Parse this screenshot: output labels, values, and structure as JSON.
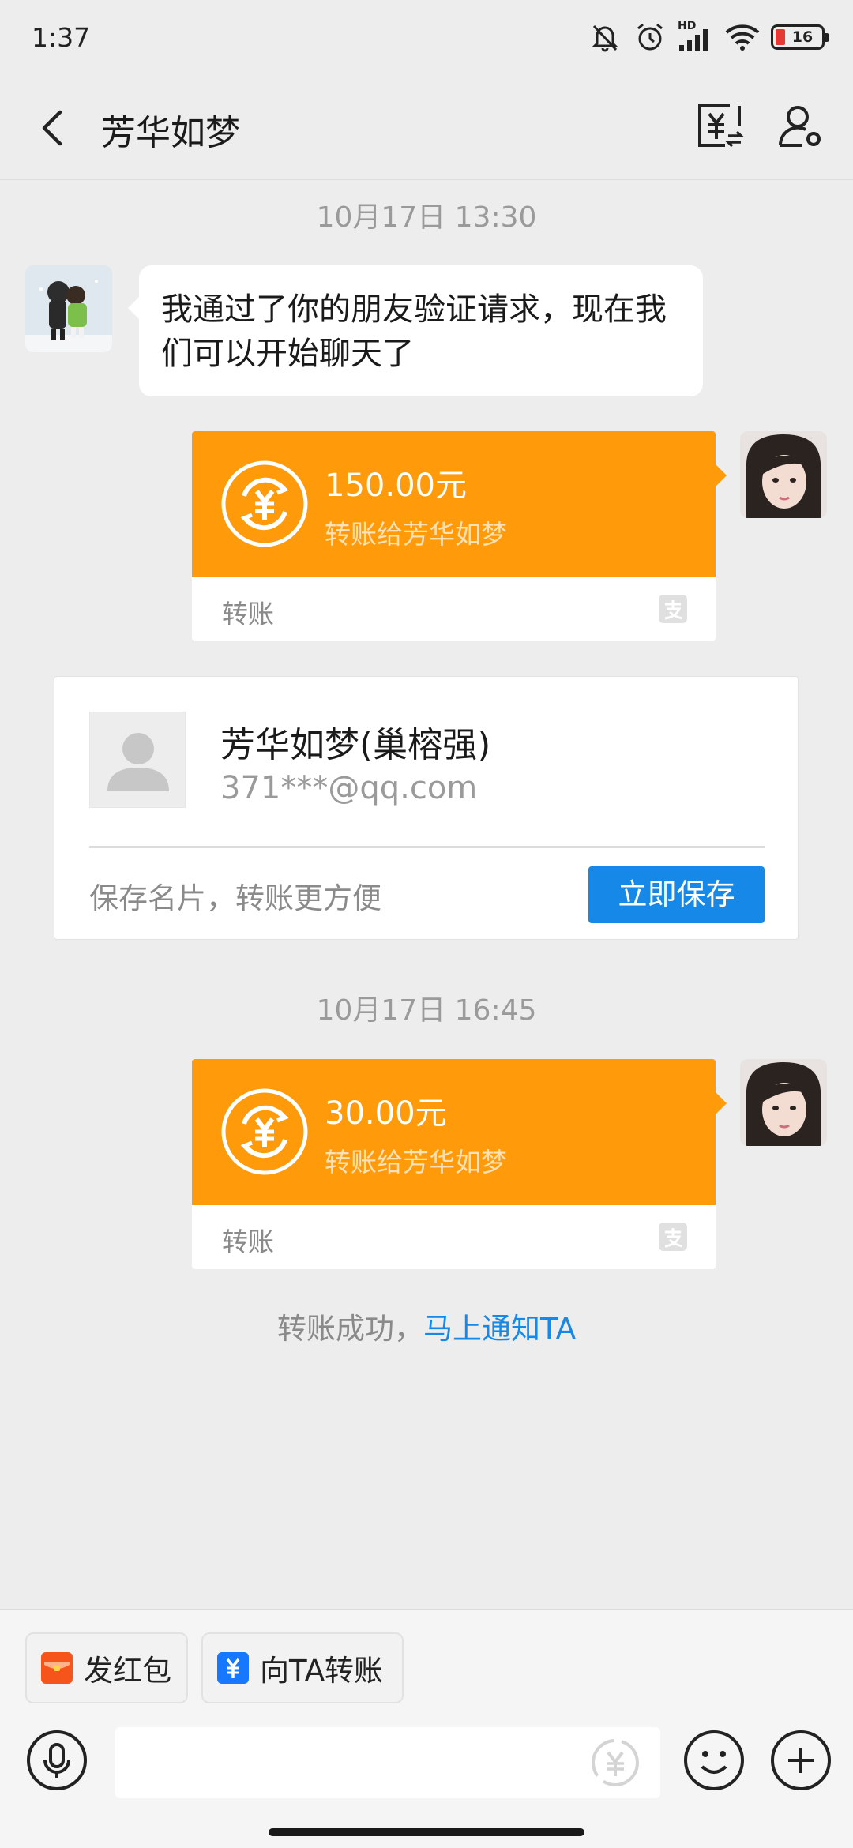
{
  "status_bar": {
    "time": "1:37",
    "network_label": "HD",
    "battery": "16"
  },
  "header": {
    "title": "芳华如梦",
    "back_icon": "chevron-left-icon",
    "transfer_icon": "yuan-transfer-icon",
    "profile_icon": "user-settings-icon"
  },
  "messages": {
    "ts1": "10月17日 13:30",
    "friend_message": "我通过了你的朋友验证请求，现在我们可以开始聊天了",
    "transfer1": {
      "amount": "150.00元",
      "desc": "转账给芳华如梦",
      "label": "转账"
    },
    "contact_card": {
      "name": "芳华如梦(巢榕强)",
      "email": "371***@qq.com",
      "hint": "保存名片，转账更方便",
      "save_label": "立即保存"
    },
    "ts2": "10月17日 16:45",
    "transfer2": {
      "amount": "30.00元",
      "desc": "转账给芳华如梦",
      "label": "转账"
    },
    "success_text": "转账成功，",
    "notify_link": "马上通知TA"
  },
  "bottom": {
    "red_packet_label": "发红包",
    "transfer_label": "向TA转账",
    "input_value": ""
  },
  "colors": {
    "transfer_orange": "#ff9a0b",
    "link_blue": "#1689e8",
    "red_packet": "#f5541b"
  }
}
